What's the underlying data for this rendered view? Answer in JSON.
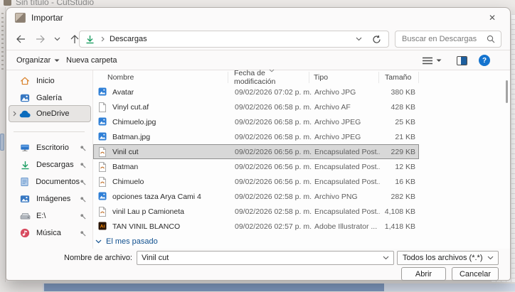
{
  "background": {
    "window_title": "Sin título - CutStudio"
  },
  "dialog": {
    "title": "Importar",
    "close_glyph": "✕",
    "nav": {
      "address_location": "Descargas",
      "search_placeholder": "Buscar en Descargas"
    },
    "toolbar": {
      "organize_label": "Organizar",
      "new_folder_label": "Nueva carpeta",
      "help_glyph": "?"
    },
    "sidebar": {
      "items": [
        {
          "label": "Inicio",
          "icon": "home-icon",
          "pinned": false,
          "expandable": false
        },
        {
          "label": "Galería",
          "icon": "gallery-icon",
          "pinned": false,
          "expandable": false
        },
        {
          "label": "OneDrive",
          "icon": "onedrive-icon",
          "pinned": false,
          "expandable": true,
          "selected": true
        },
        {
          "label": "Escritorio",
          "icon": "desktop-icon",
          "pinned": true,
          "expandable": false
        },
        {
          "label": "Descargas",
          "icon": "downloads-icon",
          "pinned": true,
          "expandable": false
        },
        {
          "label": "Documentos",
          "icon": "documents-icon",
          "pinned": true,
          "expandable": false
        },
        {
          "label": "Imágenes",
          "icon": "pictures-icon",
          "pinned": true,
          "expandable": false
        },
        {
          "label": "E:\\",
          "icon": "drive-icon",
          "pinned": true,
          "expandable": false
        },
        {
          "label": "Música",
          "icon": "music-icon",
          "pinned": true,
          "expandable": false
        }
      ]
    },
    "files": {
      "columns": [
        "Nombre",
        "Fecha de modificación",
        "Tipo",
        "Tamaño"
      ],
      "sort_column": "Fecha de modificación",
      "sort_direction": "descending",
      "rows": [
        {
          "name": "Avatar",
          "date": "09/02/2026 07:02 p. m.",
          "type": "Archivo JPG",
          "size": "380 KB",
          "icon": "image-file-icon",
          "selected": false
        },
        {
          "name": "Vinyl cut.af",
          "date": "09/02/2026 06:58 p. m.",
          "type": "Archivo AF",
          "size": "428 KB",
          "icon": "blank-file-icon",
          "selected": false
        },
        {
          "name": "Chimuelo.jpg",
          "date": "09/02/2026 06:58 p. m.",
          "type": "Archivo JPEG",
          "size": "25 KB",
          "icon": "image-file-icon",
          "selected": false
        },
        {
          "name": "Batman.jpg",
          "date": "09/02/2026 06:58 p. m.",
          "type": "Archivo JPEG",
          "size": "21 KB",
          "icon": "image-file-icon",
          "selected": false
        },
        {
          "name": "Vinil cut",
          "date": "09/02/2026 06:56 p. m.",
          "type": "Encapsulated Post...",
          "size": "229 KB",
          "icon": "eps-file-icon",
          "selected": true
        },
        {
          "name": "Batman",
          "date": "09/02/2026 06:56 p. m.",
          "type": "Encapsulated Post...",
          "size": "12 KB",
          "icon": "eps-file-icon",
          "selected": false
        },
        {
          "name": "Chimuelo",
          "date": "09/02/2026 06:56 p. m.",
          "type": "Encapsulated Post...",
          "size": "16 KB",
          "icon": "eps-file-icon",
          "selected": false
        },
        {
          "name": "opciones taza Arya Cami 4",
          "date": "09/02/2026 02:58 p. m.",
          "type": "Archivo PNG",
          "size": "282 KB",
          "icon": "image-file-icon",
          "selected": false
        },
        {
          "name": "vinil Lau p Camioneta",
          "date": "09/02/2026 02:58 p. m.",
          "type": "Encapsulated Post...",
          "size": "4,108 KB",
          "icon": "eps-file-icon",
          "selected": false
        },
        {
          "name": "TAN VINIL BLANCO",
          "date": "09/02/2026 02:57 p. m.",
          "type": "Adobe Illustrator ...",
          "size": "1,418 KB",
          "icon": "ai-file-icon",
          "selected": false
        }
      ],
      "group_label": "El mes pasado"
    },
    "footer": {
      "filename_label": "Nombre de archivo:",
      "filename_value": "Vinil cut",
      "filetype_value": "Todos los archivos (*.*)",
      "open_label": "Abrir",
      "cancel_label": "Cancelar"
    },
    "colors": {
      "accent_blue": "#1574cf",
      "selection_gray": "#d8d8d8",
      "group_header_blue": "#10508f",
      "downloads_green": "#1d9e63",
      "scrollbar_thumb_blue": "#7f99bf"
    }
  }
}
